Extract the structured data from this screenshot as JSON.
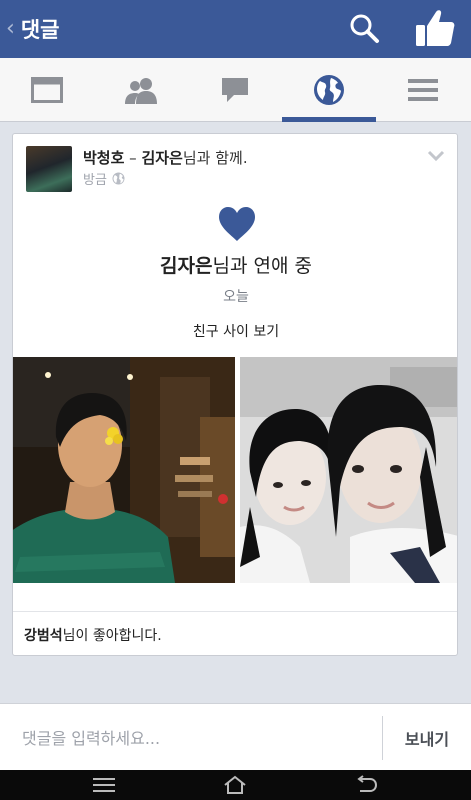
{
  "appbar": {
    "title": "댓글"
  },
  "tabs": [
    {
      "name": "news-feed"
    },
    {
      "name": "friend-requests"
    },
    {
      "name": "messages"
    },
    {
      "name": "notifications",
      "active": true
    },
    {
      "name": "more"
    }
  ],
  "post": {
    "author": "박청호",
    "dash": " – ",
    "tagged": "김자은",
    "with_suffix": "님과 함께.",
    "time": "방금",
    "relationship": {
      "partner": "김자은",
      "suffix": "님과 연애 중",
      "date": "오늘",
      "see_friendship": "친구 사이 보기"
    },
    "likes": {
      "name": "강범석",
      "suffix": "님이 좋아합니다."
    }
  },
  "composer": {
    "placeholder": "댓글을 입력하세요...",
    "send_label": "보내기"
  },
  "colors": {
    "brand": "#3b5998",
    "heart": "#3b5998"
  }
}
